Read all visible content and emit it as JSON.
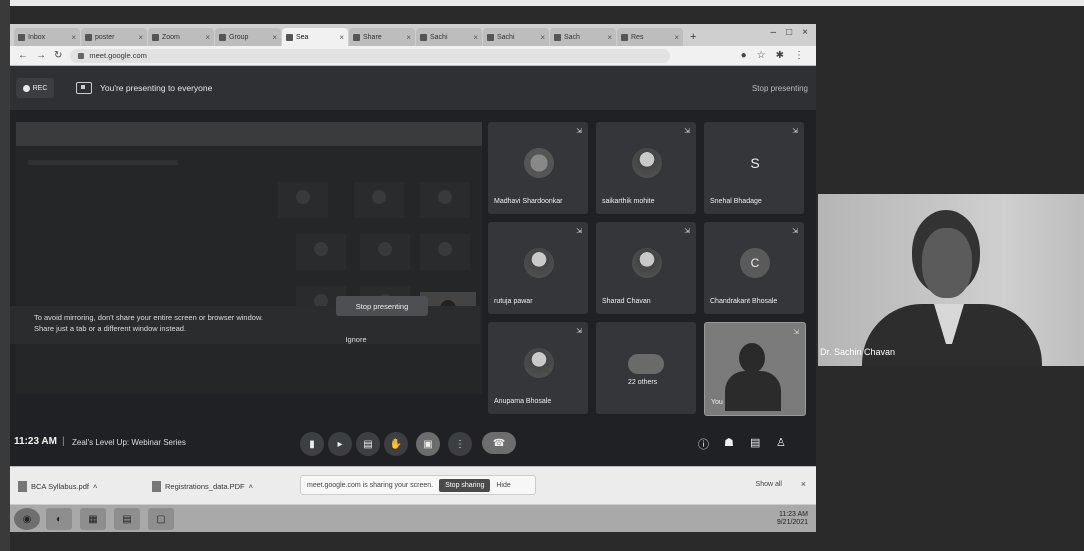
{
  "browser": {
    "tabs": [
      {
        "label": "Inbox",
        "active": false
      },
      {
        "label": "poster",
        "active": false
      },
      {
        "label": "Zoom",
        "active": false
      },
      {
        "label": "Group",
        "active": false
      },
      {
        "label": "Sea",
        "active": true
      },
      {
        "label": "Share",
        "active": false
      },
      {
        "label": "Sachi",
        "active": false
      },
      {
        "label": "Sachi",
        "active": false
      },
      {
        "label": "Sach",
        "active": false
      },
      {
        "label": "Res",
        "active": false
      }
    ],
    "url": "meet.google.com"
  },
  "meet": {
    "rec_label": "REC",
    "presenting_banner": "You're presenting to everyone",
    "stop_presenting_top": "Stop presenting",
    "warning_text_1": "To avoid mirroring, don't share your entire screen or browser window.",
    "warning_text_2": "Share just a tab or a different window instead.",
    "stop_presenting_button": "Stop presenting",
    "ignore_button": "Ignore",
    "time": "11:23 AM",
    "meeting_name": "Zeal's Level Up: Webinar Series",
    "participants": [
      {
        "name": "Madhavi Shardoonkar",
        "avatar": "globe",
        "initial": ""
      },
      {
        "name": "saikarthik mohite",
        "avatar": "photo",
        "initial": ""
      },
      {
        "name": "Snehal Bhadage",
        "avatar": "letter",
        "initial": "S"
      },
      {
        "name": "rutuja pawar",
        "avatar": "photo",
        "initial": ""
      },
      {
        "name": "Sharad Chavan",
        "avatar": "photo",
        "initial": ""
      },
      {
        "name": "Chandrakant Bhosale",
        "avatar": "letter",
        "initial": "C"
      },
      {
        "name": "Anupama Bhosale",
        "avatar": "photo",
        "initial": ""
      },
      {
        "name": "22 others",
        "avatar": "others",
        "initial": ""
      },
      {
        "name": "You",
        "avatar": "self",
        "initial": ""
      }
    ]
  },
  "downloads": {
    "item1": "BCA Syllabus.pdf",
    "item2": "Registrations_data.PDF",
    "share_text": "meet.google.com is sharing your screen.",
    "share_stop": "Stop sharing",
    "share_hide": "Hide",
    "show_all": "Show all"
  },
  "taskbar": {
    "time": "11:23 AM",
    "date": "9/21/2021"
  },
  "side_video": {
    "name": "Dr. Sachin Chavan"
  }
}
